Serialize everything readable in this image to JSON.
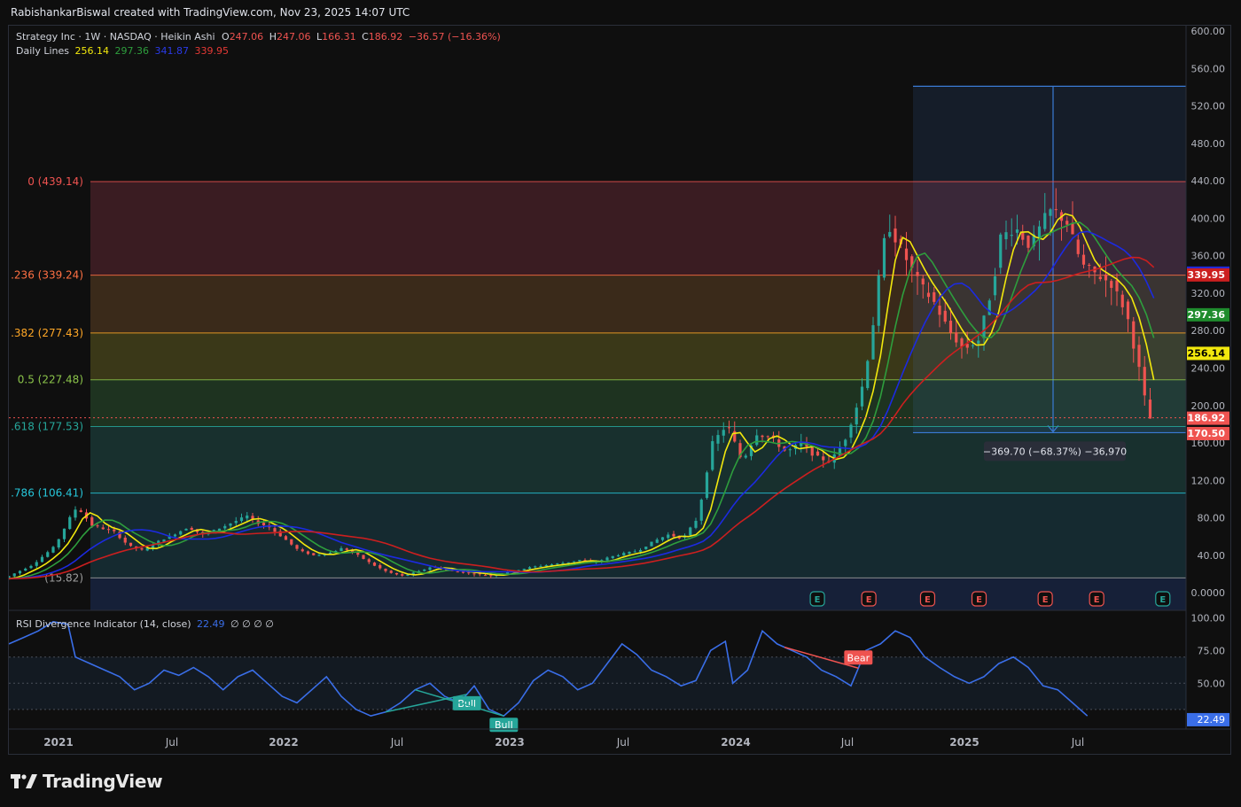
{
  "header": {
    "attribution": "RabishankarBiswal created with TradingView.com, Nov 23, 2025 14:07 UTC"
  },
  "legend": {
    "symbol": "Strategy Inc · 1W · NASDAQ · Heikin Ashi",
    "o_label": "O",
    "o_value": "247.06",
    "h_label": "H",
    "h_value": "247.06",
    "l_label": "L",
    "l_value": "166.31",
    "c_label": "C",
    "c_value": "186.92",
    "change": "−36.57 (−16.36%)",
    "daily_lines_label": "Daily Lines",
    "dl_values": [
      "256.14",
      "297.36",
      "341.87",
      "339.95"
    ],
    "rsi_label": "RSI Divergence Indicator (14, close)",
    "rsi_value": "22.49",
    "rsi_extra": "∅ ∅ ∅ ∅"
  },
  "footer": {
    "brand": "TradingView"
  },
  "colors": {
    "up": "#26a69a",
    "down": "#ef5350",
    "yellow": "#f2e80d",
    "green": "#1f8c2d",
    "blue": "#1c2ae0",
    "red": "#cc1f1f",
    "rsi": "#3a6ee8",
    "measure": "#3a7bd5"
  },
  "chart_data": [
    {
      "type": "candlestick",
      "title": "Strategy Inc · 1W · NASDAQ · Heikin Ashi",
      "ylim": [
        -15,
        600
      ],
      "y_ticks": [
        "600.00",
        "560.00",
        "520.00",
        "480.00",
        "440.00",
        "400.00",
        "360.00",
        "320.00",
        "280.00",
        "240.00",
        "200.00",
        "160.00",
        "120.00",
        "80.00",
        "40.00",
        "0.0000"
      ],
      "x_ticks": [
        "2021",
        "Jul",
        "2022",
        "Jul",
        "2023",
        "Jul",
        "2024",
        "Jul",
        "2025",
        "Jul"
      ],
      "price_keys": [
        [
          0,
          15
        ],
        [
          8,
          30
        ],
        [
          14,
          50
        ],
        [
          18,
          80
        ],
        [
          20,
          92
        ],
        [
          24,
          72
        ],
        [
          30,
          65
        ],
        [
          34,
          50
        ],
        [
          38,
          45
        ],
        [
          42,
          55
        ],
        [
          46,
          62
        ],
        [
          50,
          70
        ],
        [
          54,
          62
        ],
        [
          58,
          68
        ],
        [
          62,
          75
        ],
        [
          66,
          82
        ],
        [
          68,
          76
        ],
        [
          72,
          70
        ],
        [
          76,
          58
        ],
        [
          80,
          45
        ],
        [
          84,
          40
        ],
        [
          88,
          42
        ],
        [
          92,
          48
        ],
        [
          96,
          40
        ],
        [
          100,
          30
        ],
        [
          104,
          22
        ],
        [
          108,
          18
        ],
        [
          112,
          22
        ],
        [
          116,
          28
        ],
        [
          120,
          24
        ],
        [
          124,
          22
        ],
        [
          128,
          20
        ],
        [
          132,
          18
        ],
        [
          136,
          22
        ],
        [
          140,
          25
        ],
        [
          144,
          28
        ],
        [
          148,
          30
        ],
        [
          152,
          32
        ],
        [
          156,
          35
        ],
        [
          160,
          32
        ],
        [
          164,
          38
        ],
        [
          168,
          42
        ],
        [
          172,
          45
        ],
        [
          176,
          55
        ],
        [
          180,
          62
        ],
        [
          184,
          58
        ],
        [
          188,
          80
        ],
        [
          190,
          120
        ],
        [
          192,
          160
        ],
        [
          196,
          180
        ],
        [
          200,
          140
        ],
        [
          204,
          170
        ],
        [
          208,
          165
        ],
        [
          212,
          150
        ],
        [
          216,
          160
        ],
        [
          220,
          145
        ],
        [
          224,
          140
        ],
        [
          228,
          165
        ],
        [
          232,
          210
        ],
        [
          234,
          250
        ],
        [
          236,
          300
        ],
        [
          238,
          370
        ],
        [
          240,
          390
        ],
        [
          244,
          360
        ],
        [
          248,
          330
        ],
        [
          252,
          310
        ],
        [
          256,
          280
        ],
        [
          260,
          260
        ],
        [
          264,
          270
        ],
        [
          268,
          330
        ],
        [
          270,
          380
        ],
        [
          274,
          390
        ],
        [
          278,
          370
        ],
        [
          282,
          400
        ],
        [
          284,
          410
        ],
        [
          288,
          395
        ],
        [
          292,
          350
        ],
        [
          296,
          340
        ],
        [
          300,
          330
        ],
        [
          304,
          300
        ],
        [
          308,
          230
        ],
        [
          310,
          186
        ]
      ],
      "daily_lines": [
        {
          "name": "",
          "value": 256.14,
          "color": "#f2e80d"
        },
        {
          "name": "",
          "value": 297.36,
          "color": "#1f8c2d"
        },
        {
          "name": "",
          "value": 341.87,
          "color": "#1c2ae0"
        },
        {
          "name": "",
          "value": 339.95,
          "color": "#cc1f1f"
        }
      ],
      "fib_levels": [
        {
          "label": "0 (439.14)",
          "price": 439.14,
          "color": "#ef5350"
        },
        {
          "label": ".236 (339.24)",
          "price": 339.24,
          "color": "#ff7043"
        },
        {
          "label": ".382 (277.43)",
          "price": 277.43,
          "color": "#ffa726"
        },
        {
          "label": "0.5 (227.48)",
          "price": 227.48,
          "color": "#8bc34a"
        },
        {
          "label": ".618 (177.53)",
          "price": 177.53,
          "color": "#26a69a"
        },
        {
          "label": ".786 (106.41)",
          "price": 106.41,
          "color": "#26c6da"
        },
        {
          "label": "(15.82)",
          "price": 15.82,
          "color": "#9e9e9e"
        }
      ],
      "fib_fills": [
        "#3a1c22",
        "#3a2a1a",
        "#3a3818",
        "#1e3320",
        "#18302e",
        "#152a30",
        "#1c1c1c",
        "#162038"
      ],
      "measure": {
        "top": 541,
        "bottom": 171,
        "label": "−369.70 (−68.37%) −36,970"
      },
      "price_labels": [
        {
          "text": "341.87",
          "price": 341.87,
          "bg": "#1c2ae0",
          "fg": "#ffffff"
        },
        {
          "text": "339.95",
          "price": 339.95,
          "bg": "#cc1f1f",
          "fg": "#ffffff"
        },
        {
          "text": "297.36",
          "price": 297.36,
          "bg": "#1f8c2d",
          "fg": "#ffffff"
        },
        {
          "text": "256.14",
          "price": 256.14,
          "bg": "#f2e80d",
          "fg": "#000000"
        },
        {
          "text": "186.92",
          "price": 186.92,
          "bg": "#ef5350",
          "fg": "#ffffff"
        },
        {
          "text": "170.50",
          "price": 170.5,
          "bg": "#ef5350",
          "fg": "#ffffff"
        }
      ],
      "events": [
        {
          "t": 220,
          "kind": "E",
          "color": "#26a69a"
        },
        {
          "t": 234,
          "kind": "E",
          "color": "#ef5350"
        },
        {
          "t": 250,
          "kind": "E",
          "color": "#ef5350"
        },
        {
          "t": 264,
          "kind": "E",
          "color": "#ef5350"
        },
        {
          "t": 282,
          "kind": "E",
          "color": "#ef5350"
        },
        {
          "t": 296,
          "kind": "E",
          "color": "#ef5350"
        },
        {
          "t": 314,
          "kind": "E",
          "color": "#26a69a"
        },
        {
          "t": 328,
          "kind": "E",
          "color": "#26a69a"
        }
      ]
    },
    {
      "type": "line",
      "title": "RSI Divergence Indicator (14, close)",
      "ylim": [
        15,
        105
      ],
      "y_ticks": [
        "100.00",
        "75.00",
        "50.00"
      ],
      "current": "22.49",
      "rsi_keys": [
        [
          0,
          80
        ],
        [
          4,
          85
        ],
        [
          8,
          90
        ],
        [
          12,
          97
        ],
        [
          16,
          95
        ],
        [
          18,
          70
        ],
        [
          22,
          65
        ],
        [
          26,
          60
        ],
        [
          30,
          55
        ],
        [
          34,
          45
        ],
        [
          38,
          50
        ],
        [
          42,
          60
        ],
        [
          46,
          56
        ],
        [
          50,
          62
        ],
        [
          54,
          55
        ],
        [
          58,
          45
        ],
        [
          62,
          55
        ],
        [
          66,
          60
        ],
        [
          70,
          50
        ],
        [
          74,
          40
        ],
        [
          78,
          35
        ],
        [
          82,
          45
        ],
        [
          86,
          55
        ],
        [
          90,
          40
        ],
        [
          94,
          30
        ],
        [
          98,
          25
        ],
        [
          102,
          28
        ],
        [
          106,
          35
        ],
        [
          110,
          45
        ],
        [
          114,
          50
        ],
        [
          118,
          40
        ],
        [
          122,
          35
        ],
        [
          126,
          48
        ],
        [
          130,
          30
        ],
        [
          134,
          25
        ],
        [
          138,
          35
        ],
        [
          142,
          52
        ],
        [
          146,
          60
        ],
        [
          150,
          55
        ],
        [
          154,
          45
        ],
        [
          158,
          50
        ],
        [
          162,
          65
        ],
        [
          166,
          80
        ],
        [
          170,
          72
        ],
        [
          174,
          60
        ],
        [
          178,
          55
        ],
        [
          182,
          48
        ],
        [
          186,
          52
        ],
        [
          190,
          75
        ],
        [
          194,
          82
        ],
        [
          196,
          50
        ],
        [
          200,
          60
        ],
        [
          204,
          90
        ],
        [
          208,
          80
        ],
        [
          212,
          75
        ],
        [
          216,
          70
        ],
        [
          220,
          60
        ],
        [
          224,
          55
        ],
        [
          228,
          48
        ],
        [
          232,
          75
        ],
        [
          236,
          80
        ],
        [
          240,
          90
        ],
        [
          244,
          85
        ],
        [
          248,
          70
        ],
        [
          252,
          62
        ],
        [
          256,
          55
        ],
        [
          260,
          50
        ],
        [
          264,
          55
        ],
        [
          268,
          65
        ],
        [
          272,
          70
        ],
        [
          276,
          62
        ],
        [
          280,
          48
        ],
        [
          284,
          45
        ],
        [
          288,
          35
        ],
        [
          292,
          25
        ]
      ],
      "divergences": [
        {
          "t0": 102,
          "t1": 124,
          "label": "Bull",
          "color": "#26a69a"
        },
        {
          "t0": 110,
          "t1": 134,
          "label": "Bull",
          "color": "#26a69a"
        },
        {
          "t0": 210,
          "t1": 230,
          "label": "Bear",
          "color": "#ef5350"
        }
      ]
    }
  ]
}
